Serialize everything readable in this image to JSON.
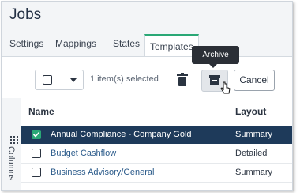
{
  "page": {
    "title": "Jobs"
  },
  "tabs": [
    {
      "label": "Settings"
    },
    {
      "label": "Mappings"
    },
    {
      "label": "States"
    },
    {
      "label": "Templates"
    }
  ],
  "toolbar": {
    "selected_text": "1 item(s) selected",
    "cancel_label": "Cancel",
    "tooltip": "Archive",
    "icons": [
      "checkbox-dropdown",
      "trash-icon",
      "archive-icon",
      "cursor-hand-icon"
    ]
  },
  "side_panel": {
    "label": "Columns"
  },
  "table": {
    "headers": {
      "name": "Name",
      "layout": "Layout"
    },
    "rows": [
      {
        "name": "Annual Compliance - Company Gold",
        "layout": "Summary",
        "selected": true
      },
      {
        "name": "Budget Cashflow",
        "layout": "Detailed",
        "selected": false
      },
      {
        "name": "Business Advisory/General",
        "layout": "Summary",
        "selected": false
      }
    ]
  },
  "colors": {
    "accent": "#2aa876",
    "selected_row": "#1e3a5a",
    "link": "#2a5a8a"
  }
}
